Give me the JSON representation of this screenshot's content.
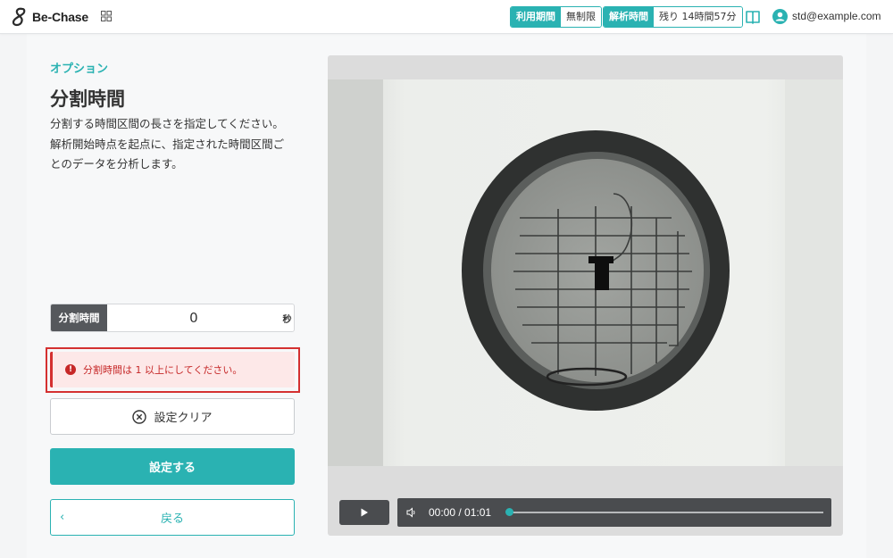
{
  "header": {
    "logo_text": "Be-Chase",
    "usage_period": {
      "label": "利用期間",
      "value": "無制限"
    },
    "analysis_time": {
      "label": "解析時間",
      "value": "残り 14時間57分"
    },
    "user_email": "std@example.com"
  },
  "option": {
    "section_label": "オプション",
    "title": "分割時間",
    "description": [
      "分割する時間区間の長さを指定してください。",
      "解析開始時点を起点に、指定された時間区間ご",
      "とのデータを分析します。"
    ],
    "field": {
      "label": "分割時間",
      "value": "0",
      "unit": "秒"
    },
    "error": {
      "icon": "!",
      "text": "分割時間は 1 以上にしてください。"
    },
    "buttons": {
      "clear": "設定クリア",
      "set": "設定する",
      "back": "戻る"
    }
  },
  "video": {
    "time_display": "00:00 / 01:01",
    "progress": 0
  },
  "colors": {
    "accent": "#2ab2b2",
    "error": "#d43030",
    "dark": "#55585c"
  }
}
